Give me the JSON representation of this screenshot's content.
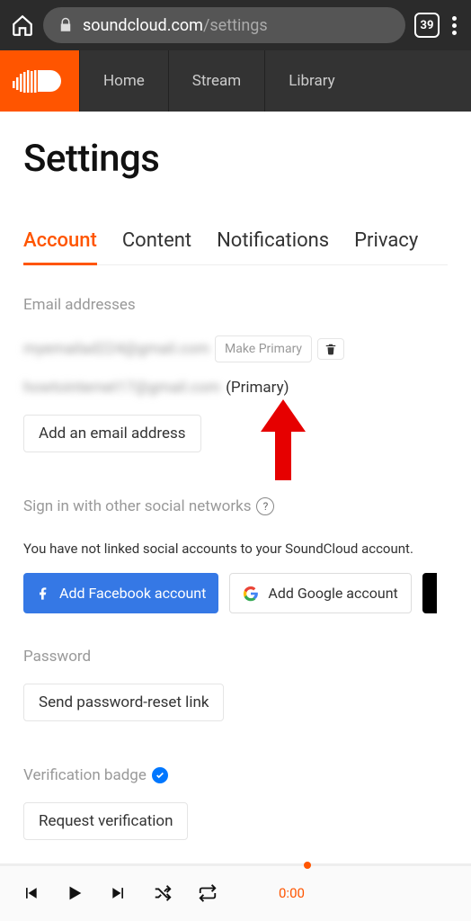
{
  "browser": {
    "url_host": "soundcloud.com",
    "url_path": "/settings",
    "tab_count": "39"
  },
  "nav": {
    "items": [
      "Home",
      "Stream",
      "Library"
    ]
  },
  "page": {
    "title": "Settings"
  },
  "tabs": [
    {
      "label": "Account",
      "active": true
    },
    {
      "label": "Content",
      "active": false
    },
    {
      "label": "Notifications",
      "active": false
    },
    {
      "label": "Privacy",
      "active": false
    }
  ],
  "emails_section": {
    "heading": "Email addresses",
    "entries": [
      {
        "address": "myemailad224@gmail.com",
        "make_primary_label": "Make Primary",
        "is_primary": false
      },
      {
        "address": "howtointernet17@gmail.com",
        "is_primary": true,
        "primary_tag": "(Primary)"
      }
    ],
    "add_button": "Add an email address"
  },
  "social_section": {
    "heading": "Sign in with other social networks",
    "info": "You have not linked social accounts to your SoundCloud account.",
    "facebook_label": "Add Facebook account",
    "google_label": "Add Google account"
  },
  "password_section": {
    "heading": "Password",
    "button": "Send password-reset link"
  },
  "verification_section": {
    "heading": "Verification badge",
    "button": "Request verification"
  },
  "player": {
    "time": "0:00"
  }
}
